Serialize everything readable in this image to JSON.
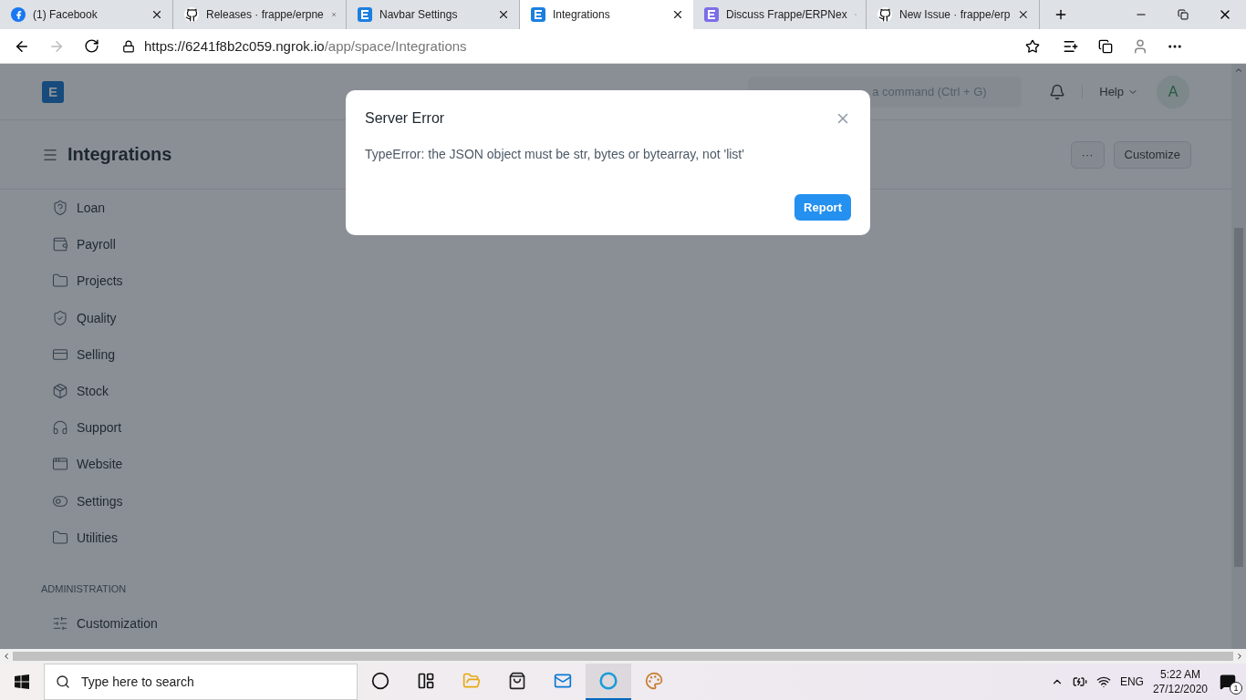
{
  "browser": {
    "tabs": [
      {
        "kind": "facebook",
        "title": "(1) Facebook",
        "selected": false
      },
      {
        "kind": "github",
        "title": "Releases · frappe/erpne",
        "selected": false
      },
      {
        "kind": "erpnext",
        "title": "Navbar Settings",
        "selected": false
      },
      {
        "kind": "erpnext",
        "title": "Integrations",
        "selected": true
      },
      {
        "kind": "discuss",
        "title": "Discuss Frappe/ERPNex",
        "selected": false
      },
      {
        "kind": "github",
        "title": "New Issue · frappe/erp",
        "selected": false
      }
    ],
    "url_host": "https://6241f8b2c059.ngrok.io",
    "url_path": "/app/space/Integrations"
  },
  "navbar": {
    "logo": "E",
    "search": {
      "placeholder": "a command (Ctrl + G)"
    },
    "help": "Help",
    "avatar": "A"
  },
  "page": {
    "title": "Integrations",
    "more": "···",
    "customize": "Customize"
  },
  "sidebar": {
    "items": [
      {
        "kind": "loan",
        "label": "Loan"
      },
      {
        "kind": "payroll",
        "label": "Payroll"
      },
      {
        "kind": "folder",
        "label": "Projects"
      },
      {
        "kind": "shield",
        "label": "Quality"
      },
      {
        "kind": "card",
        "label": "Selling"
      },
      {
        "kind": "box",
        "label": "Stock"
      },
      {
        "kind": "headset",
        "label": "Support"
      },
      {
        "kind": "browser",
        "label": "Website"
      },
      {
        "kind": "toggles",
        "label": "Settings"
      },
      {
        "kind": "folder",
        "label": "Utilities"
      }
    ],
    "section": "ADMINISTRATION",
    "admin_items": [
      {
        "kind": "sliders",
        "label": "Customization"
      }
    ]
  },
  "dialog": {
    "title": "Server Error",
    "message": "TypeError: the JSON object must be str, bytes or bytearray, not 'list'",
    "button": "Report"
  },
  "taskbar": {
    "search": {
      "placeholder": "Type here to search"
    },
    "apps": [
      {
        "kind": "cortana",
        "active": false
      },
      {
        "kind": "taskview",
        "active": false
      },
      {
        "kind": "explorer",
        "active": false
      },
      {
        "kind": "store",
        "active": false
      },
      {
        "kind": "mail",
        "active": false
      },
      {
        "kind": "edge",
        "active": true
      },
      {
        "kind": "paint",
        "active": false
      }
    ],
    "language": "ENG",
    "time": "5:22 AM",
    "date": "27/12/2020",
    "notifications": "1"
  }
}
